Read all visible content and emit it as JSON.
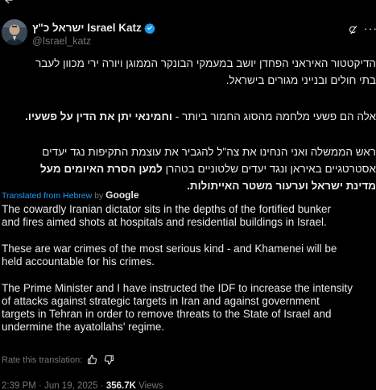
{
  "header": {
    "display_name_hebrew": "ישראל כ\"ץ",
    "display_name_english": "Israel Katz",
    "handle": "@Israel_katz"
  },
  "icons": {
    "back": "arrow-left-icon",
    "verified": "verified-badge-icon",
    "grok": "grok-icon",
    "more": "more-options-icon",
    "thumbs_up": "thumbs-up-icon",
    "thumbs_down": "thumbs-down-icon"
  },
  "colors": {
    "background": "#000000",
    "text": "#e7e9ea",
    "muted": "#71767b",
    "accent": "#1d9bf0"
  },
  "hebrew": {
    "p1_line1": "הדיקטטור האיראני הפחדן יושב במעמקי הבונקר הממוגן ויורה ירי מכוון לעבר",
    "p1_line2": "בתי חולים ובנייני מגורים בישראל.",
    "p2_regular": "אלה הם פשעי מלחמה מהסוג החמור ביותר - ",
    "p2_bold": "וחמינאי יתן את הדין על פשעיו.",
    "p3_line1": "ראש הממשלה ואני הנחינו את צה\"ל להגביר את עוצמת התקיפות נגד יעדים",
    "p3_line2_regular": "אסטרטגיים באיראן ונגד יעדים שלטוניים בטהרן ",
    "p3_line2_bold": "למען הסרת האיומים מעל",
    "p3_line3_bold": "מדינת ישראל וערעור משטר האייתולות."
  },
  "translation": {
    "label": "Translated from Hebrew",
    "by": "by",
    "provider": "Google"
  },
  "english": {
    "p1_line1": "The cowardly Iranian dictator sits in the depths of the fortified bunker",
    "p1_line2": "and fires aimed shots at hospitals and residential buildings in Israel.",
    "p2_line1": "These are war crimes of the most serious kind - and Khamenei will be",
    "p2_line2": "held accountable for his crimes.",
    "p3_line1": "The Prime Minister and I have instructed the IDF to increase the intensity",
    "p3_line2": "of attacks against strategic targets in Iran and against government",
    "p3_line3": "targets in Tehran in order to remove threats to the State of Israel and",
    "p3_line4": "undermine the ayatollahs' regime."
  },
  "rate": {
    "label": "Rate this translation:"
  },
  "meta": {
    "time": "2:39 PM",
    "separator": " · ",
    "date": "Jun 19, 2025",
    "views_count": "356.7K",
    "views_label": "Views"
  }
}
